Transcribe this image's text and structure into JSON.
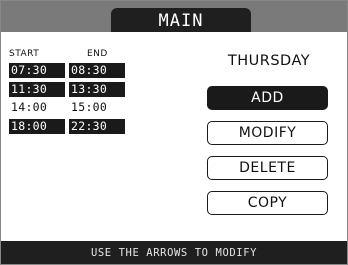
{
  "header": {
    "title": "MAIN"
  },
  "schedule": {
    "start_header": "START",
    "end_header": "END",
    "rows": [
      {
        "start": "07:30",
        "end": "08:30",
        "selected": true
      },
      {
        "start": "11:30",
        "end": "13:30",
        "selected": true
      },
      {
        "start": "14:00",
        "end": "15:00",
        "selected": false
      },
      {
        "start": "18:00",
        "end": "22:30",
        "selected": true
      }
    ]
  },
  "day": "THURSDAY",
  "buttons": {
    "add": "ADD",
    "modify": "MODIFY",
    "delete": "DELETE",
    "copy": "COPY"
  },
  "footer": {
    "hint": "USE THE ARROWS TO MODIFY"
  },
  "colors": {
    "top_bar": "#7a7a7a",
    "dark": "#1a1a1a",
    "background": "#ffffff"
  }
}
